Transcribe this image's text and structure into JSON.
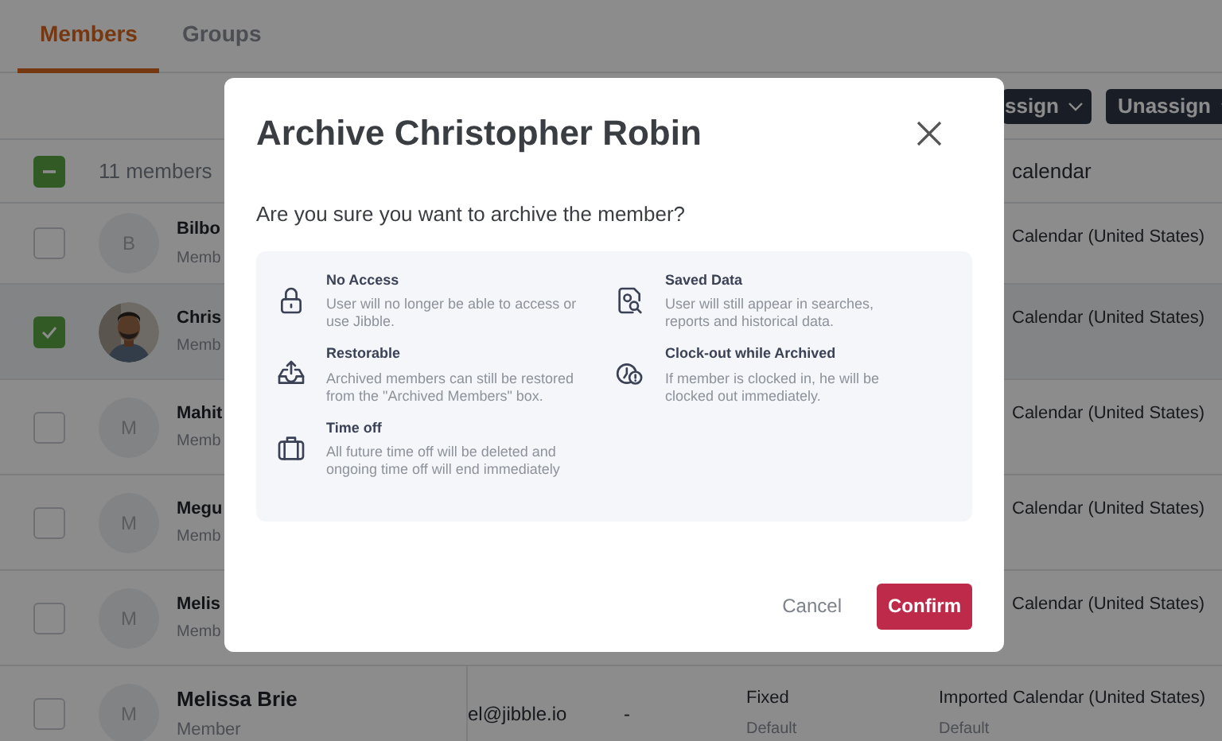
{
  "tabs": [
    {
      "label": "Members",
      "selected": true
    },
    {
      "label": "Groups",
      "selected": false
    }
  ],
  "toolbar": {
    "buttons": [
      "ssign",
      "Unassign"
    ]
  },
  "table": {
    "select_all": {
      "checked": true,
      "indeterminate": true
    },
    "count": "11 members",
    "column_header": "calendar",
    "rows": [
      {
        "name": "Bilbo",
        "role": "Memb",
        "avatar": {
          "kind": "initial",
          "initial": "B"
        },
        "selected": false,
        "calendar": "Calendar (United States)"
      },
      {
        "name": "Chris",
        "role": "Memb",
        "selected": true,
        "calendar": "Calendar (United States)"
      },
      {
        "name": "Mahit",
        "role": "Memb",
        "avatar": {
          "kind": "initial",
          "initial": "M"
        },
        "selected": false,
        "calendar": "Calendar (United States)"
      },
      {
        "name": "Megu",
        "role": "Memb",
        "avatar": {
          "kind": "initial",
          "initial": "M"
        },
        "selected": false,
        "calendar": "Calendar (United States)"
      },
      {
        "name": "Melis",
        "role": "Memb",
        "avatar": {
          "kind": "initial",
          "initial": "M"
        },
        "selected": false,
        "calendar": "Calendar (United States)"
      },
      {
        "name": "Melissa Brie",
        "role": "Member",
        "avatar": {
          "kind": "initial",
          "initial": "M"
        },
        "selected": false,
        "email": "el@jibble.io",
        "column_dash": "-",
        "schedule": "Fixed",
        "schedule_sub": "Default",
        "calendar": "Imported Calendar (United States)",
        "calendar_sub": "Default"
      }
    ]
  },
  "dialog": {
    "title": "Archive Christopher Robin",
    "question": "Are you sure you want to archive the member?",
    "items": [
      {
        "kind": "lock",
        "title": "No Access",
        "text": "User will no longer be able to access or use Jibble."
      },
      {
        "kind": "search-doc",
        "title": "Saved Data",
        "text": "User will still appear in searches, reports and historical data."
      },
      {
        "kind": "upload-tray",
        "title": "Restorable",
        "text": "Archived members can still be restored from the \"Archived Members\" box."
      },
      {
        "kind": "clock-alert",
        "title": "Clock-out while Archived",
        "text": "If member is clocked in, he will be clocked out immediately."
      },
      {
        "kind": "suitcase",
        "title": "Time off",
        "text": "All future time off will be deleted and ongoing time off will end immediately"
      }
    ],
    "cancel": "Cancel",
    "confirm": "Confirm"
  }
}
